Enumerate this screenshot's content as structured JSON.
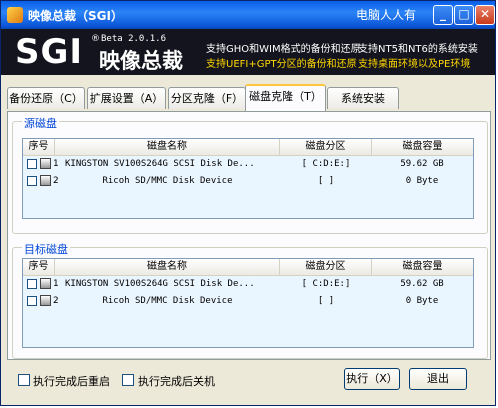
{
  "window": {
    "title": "映像总裁（SGI）",
    "watermark": "电脑人人有",
    "controls": {
      "minimize": "_",
      "maximize": "□",
      "close": "✕"
    }
  },
  "banner": {
    "logo": "SGI",
    "registered": "®",
    "version": "Beta 2.0.1.6",
    "product": "映像总裁",
    "features": [
      "支持GHO和WIM格式的备份和还原",
      "支持NT5和NT6的系统安装",
      "支持UEFI+GPT分区的备份和还原",
      "支持桌面环境以及PE环境"
    ]
  },
  "tabs": [
    {
      "label": "备份还原（C）"
    },
    {
      "label": "扩展设置（A）"
    },
    {
      "label": "分区克隆（F）"
    },
    {
      "label": "磁盘克隆（T）"
    },
    {
      "label": "系统安装"
    }
  ],
  "active_tab": "磁盘克隆（T）",
  "source": {
    "label": "源磁盘",
    "columns": [
      "序号",
      "磁盘名称",
      "磁盘分区",
      "磁盘容量"
    ],
    "rows": [
      {
        "index": "1",
        "name": "KINGSTON  SV100S264G SCSI Disk De...",
        "partitions": "[ C:D:E:]",
        "capacity": "59.62 GB"
      },
      {
        "index": "2",
        "name": "Ricoh SD/MMC Disk Device",
        "partitions": "[ ]",
        "capacity": "0 Byte"
      }
    ]
  },
  "target": {
    "label": "目标磁盘",
    "columns": [
      "序号",
      "磁盘名称",
      "磁盘分区",
      "磁盘容量"
    ],
    "rows": [
      {
        "index": "1",
        "name": "KINGSTON  SV100S264G SCSI Disk De...",
        "partitions": "[ C:D:E:]",
        "capacity": "59.62 GB"
      },
      {
        "index": "2",
        "name": "Ricoh SD/MMC Disk Device",
        "partitions": "[ ]",
        "capacity": "0 Byte"
      }
    ]
  },
  "footer": {
    "restart_label": "执行完成后重启",
    "shutdown_label": "执行完成后关机",
    "execute_label": "执行（X）",
    "exit_label": "退出"
  }
}
